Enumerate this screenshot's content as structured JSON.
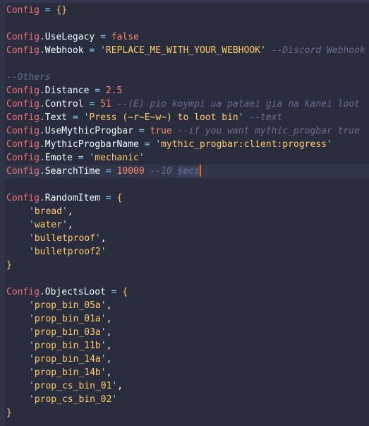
{
  "editor": {
    "lines": [
      {
        "var": "Config",
        "op": "=",
        "open": "{}"
      },
      {},
      {
        "var": "Config",
        "prop": "UseLegacy",
        "op": "=",
        "value": "false"
      },
      {
        "var": "Config",
        "prop": "Webhook",
        "op": "=",
        "string": "REPLACE_ME_WITH_YOUR_WEBHOOK",
        "comment": "--Discord Webhook"
      },
      {},
      {
        "comment": "--Others"
      },
      {
        "var": "Config",
        "prop": "Distance",
        "op": "=",
        "value": "2.5"
      },
      {
        "var": "Config",
        "prop": "Control",
        "op": "=",
        "value": "51",
        "comment": "--(E) pio koympi ua pataei gia na kanei loot"
      },
      {
        "var": "Config",
        "prop": "Text",
        "op": "=",
        "string": "Press (~r~E~w~) to loot bin",
        "comment": "--text"
      },
      {
        "var": "Config",
        "prop": "UseMythicProgbar",
        "op": "=",
        "value": "true",
        "comment": "--if you want mythic_progbar true"
      },
      {
        "var": "Config",
        "prop": "MythicProgbarName",
        "op": "=",
        "string": "mythic_progbar:client:progress"
      },
      {
        "var": "Config",
        "prop": "Emote",
        "op": "=",
        "string": "mechanic"
      },
      {
        "var": "Config",
        "prop": "SearchTime",
        "op": "=",
        "value": "10000",
        "comment_pre": "--10 ",
        "comment_sel": "secs"
      },
      {},
      {
        "var": "Config",
        "prop": "RandomItem",
        "op": "=",
        "open": "{"
      },
      {
        "item": "bread",
        "comma": ","
      },
      {
        "item": "water",
        "comma": ","
      },
      {
        "item": "bulletproof",
        "comma": ","
      },
      {
        "item": "bulletproof2"
      },
      {
        "close": "}"
      },
      {},
      {
        "var": "Config",
        "prop": "ObjectsLoot",
        "op": "=",
        "open": "{"
      },
      {
        "item": "prop_bin_05a",
        "comma": ","
      },
      {
        "item": "prop_bin_01a",
        "comma": ","
      },
      {
        "item": "prop_bin_03a",
        "comma": ","
      },
      {
        "item": "prop_bin_11b",
        "comma": ","
      },
      {
        "item": "prop_bin_14a",
        "comma": ","
      },
      {
        "item": "prop_bin_14b",
        "comma": ","
      },
      {
        "item": "prop_cs_bin_01",
        "comma": ","
      },
      {
        "item": "prop_cs_bin_02"
      },
      {
        "close": "}"
      }
    ],
    "current_line": 12,
    "colors": {
      "background": "#292d3e",
      "variable": "#f07178",
      "string": "#ffcb6b",
      "number": "#f78c6c",
      "comment": "#676e95",
      "cursor": "#ff6a00"
    }
  }
}
